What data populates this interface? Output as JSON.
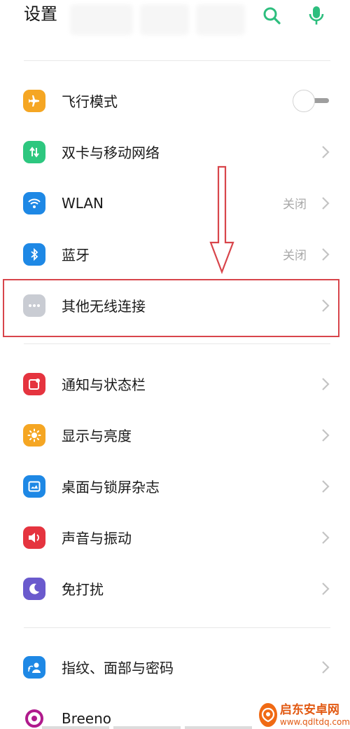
{
  "header": {
    "title": "设置"
  },
  "groups": [
    {
      "items": [
        {
          "label": "飞行模式",
          "control": "toggle",
          "toggle_state": "off",
          "color": "#F5A623"
        },
        {
          "label": "双卡与移动网络",
          "color": "#2DC77F"
        },
        {
          "label": "WLAN",
          "value": "关闭",
          "color": "#1E88E5"
        },
        {
          "label": "蓝牙",
          "value": "关闭",
          "color": "#1E88E5"
        },
        {
          "label": "其他无线连接",
          "color": "#C9CCD3",
          "highlighted": true
        }
      ]
    },
    {
      "items": [
        {
          "label": "通知与状态栏",
          "color": "#E5343F"
        },
        {
          "label": "显示与亮度",
          "color": "#F5A623"
        },
        {
          "label": "桌面与锁屏杂志",
          "color": "#1E88E5"
        },
        {
          "label": "声音与振动",
          "color": "#E5343F"
        },
        {
          "label": "免打扰",
          "color": "#6A5ACD"
        }
      ]
    },
    {
      "items": [
        {
          "label": "指纹、面部与密码",
          "color": "#1E88E5"
        },
        {
          "label": "Breeno",
          "color": "#B01A8C"
        }
      ]
    }
  ],
  "annotation": {
    "color": "#D8454B"
  },
  "watermark": {
    "name": "启东安卓网",
    "url": "www.qdltdq.com"
  }
}
